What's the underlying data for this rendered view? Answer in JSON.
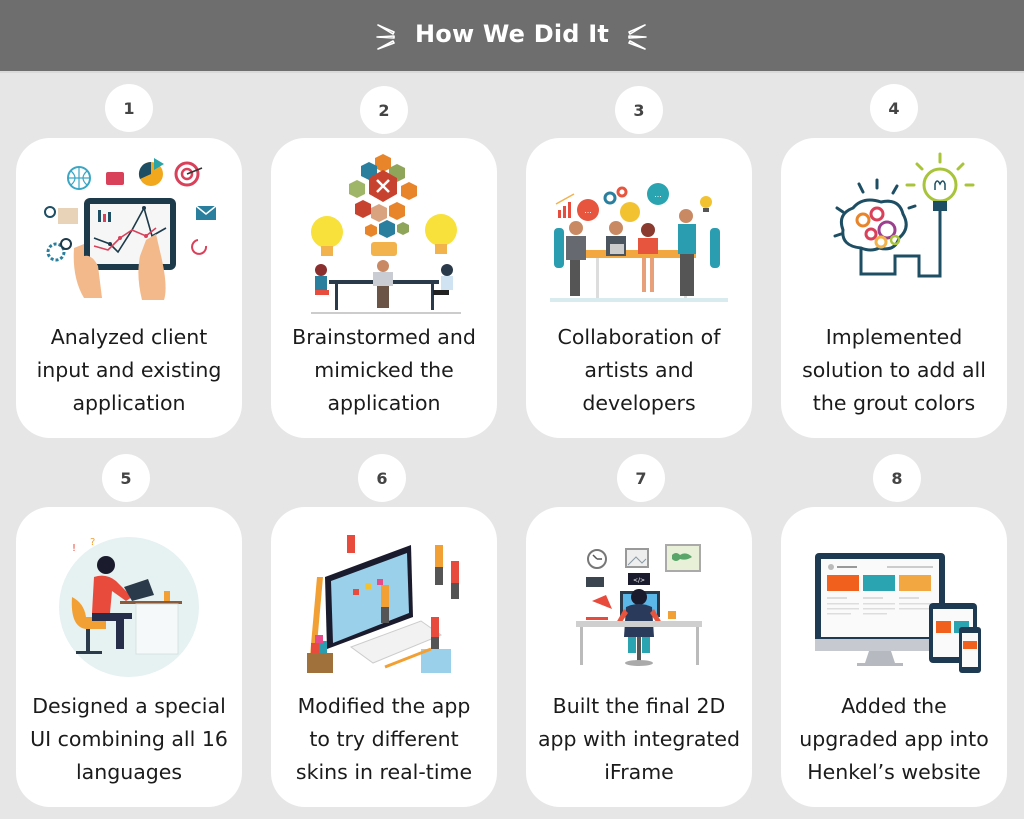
{
  "header": {
    "title": "How We Did It",
    "background_color": "#6e6e6e",
    "decoration_icon": "burst-lines-icon"
  },
  "page": {
    "background_color": "#e6e6e6",
    "card_color": "#ffffff"
  },
  "steps": [
    {
      "number": "1",
      "lines": [
        "Analyzed client",
        "input and existing",
        "application"
      ],
      "illustration": "tablet-analytics-illustration"
    },
    {
      "number": "2",
      "lines": [
        "Brainstormed and",
        "mimicked the",
        "application"
      ],
      "illustration": "brainstorm-lightbulbs-illustration"
    },
    {
      "number": "3",
      "lines": [
        "Collaboration of",
        "artists and",
        "developers"
      ],
      "illustration": "team-meeting-illustration"
    },
    {
      "number": "4",
      "lines": [
        "Implemented",
        "solution to add all",
        "the grout colors"
      ],
      "illustration": "brain-gears-lightbulb-illustration"
    },
    {
      "number": "5",
      "lines": [
        "Designed a special",
        "UI combining all 16",
        "languages"
      ],
      "illustration": "designer-at-desk-illustration"
    },
    {
      "number": "6",
      "lines": [
        "Modified the app",
        "to try different",
        "skins in real-time"
      ],
      "illustration": "team-building-screen-illustration"
    },
    {
      "number": "7",
      "lines": [
        "Built the final 2D",
        "app with integrated",
        "iFrame"
      ],
      "illustration": "developer-at-computer-illustration"
    },
    {
      "number": "8",
      "lines": [
        "Added the",
        "upgraded app into",
        "Henkel’s website"
      ],
      "illustration": "responsive-devices-illustration"
    }
  ]
}
